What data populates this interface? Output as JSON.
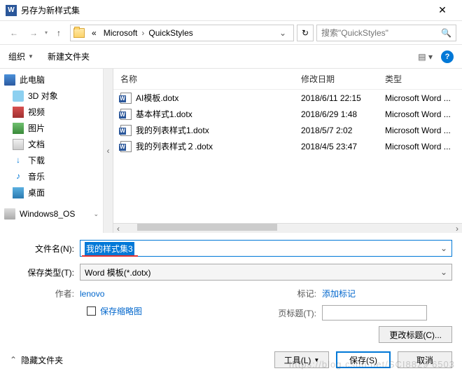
{
  "window": {
    "title": "另存为新样式集",
    "close": "✕"
  },
  "nav": {
    "back": "←",
    "forward": "→",
    "up": "↑",
    "crumb_prefix": "«",
    "crumb1": "Microsoft",
    "crumb2": "QuickStyles",
    "refresh": "↻",
    "search_placeholder": "搜索\"QuickStyles\""
  },
  "toolbar": {
    "organize": "组织",
    "new_folder": "新建文件夹",
    "help": "?"
  },
  "sidebar": {
    "items": [
      {
        "label": "此电脑"
      },
      {
        "label": "3D 对象"
      },
      {
        "label": "视频"
      },
      {
        "label": "图片"
      },
      {
        "label": "文档"
      },
      {
        "label": "下载"
      },
      {
        "label": "音乐"
      },
      {
        "label": "桌面"
      },
      {
        "label": "Windows8_OS"
      }
    ]
  },
  "columns": {
    "name": "名称",
    "date": "修改日期",
    "type": "类型"
  },
  "files": [
    {
      "name": "AI模板.dotx",
      "date": "2018/6/11 22:15",
      "type": "Microsoft Word ..."
    },
    {
      "name": "基本样式1.dotx",
      "date": "2018/6/29 1:48",
      "type": "Microsoft Word ..."
    },
    {
      "name": "我的列表样式1.dotx",
      "date": "2018/5/7 2:02",
      "type": "Microsoft Word ..."
    },
    {
      "name": "我的列表样式２.dotx",
      "date": "2018/4/5 23:47",
      "type": "Microsoft Word ..."
    }
  ],
  "form": {
    "filename_label": "文件名(N):",
    "filename_value": "我的样式集3",
    "filetype_label": "保存类型(T):",
    "filetype_value": "Word 模板(*.dotx)",
    "author_label": "作者:",
    "author_value": "lenovo",
    "tags_label": "标记:",
    "tags_value": "添加标记",
    "save_thumb": "保存缩略图",
    "page_title_label": "页标题(T):",
    "change_title": "更改标题(C)..."
  },
  "footer": {
    "hide_folders": "隐藏文件夹",
    "tools": "工具(L)",
    "save": "保存(S)",
    "cancel": "取消"
  },
  "watermark": "https://blog.csdn.net/SCI8829   6503"
}
